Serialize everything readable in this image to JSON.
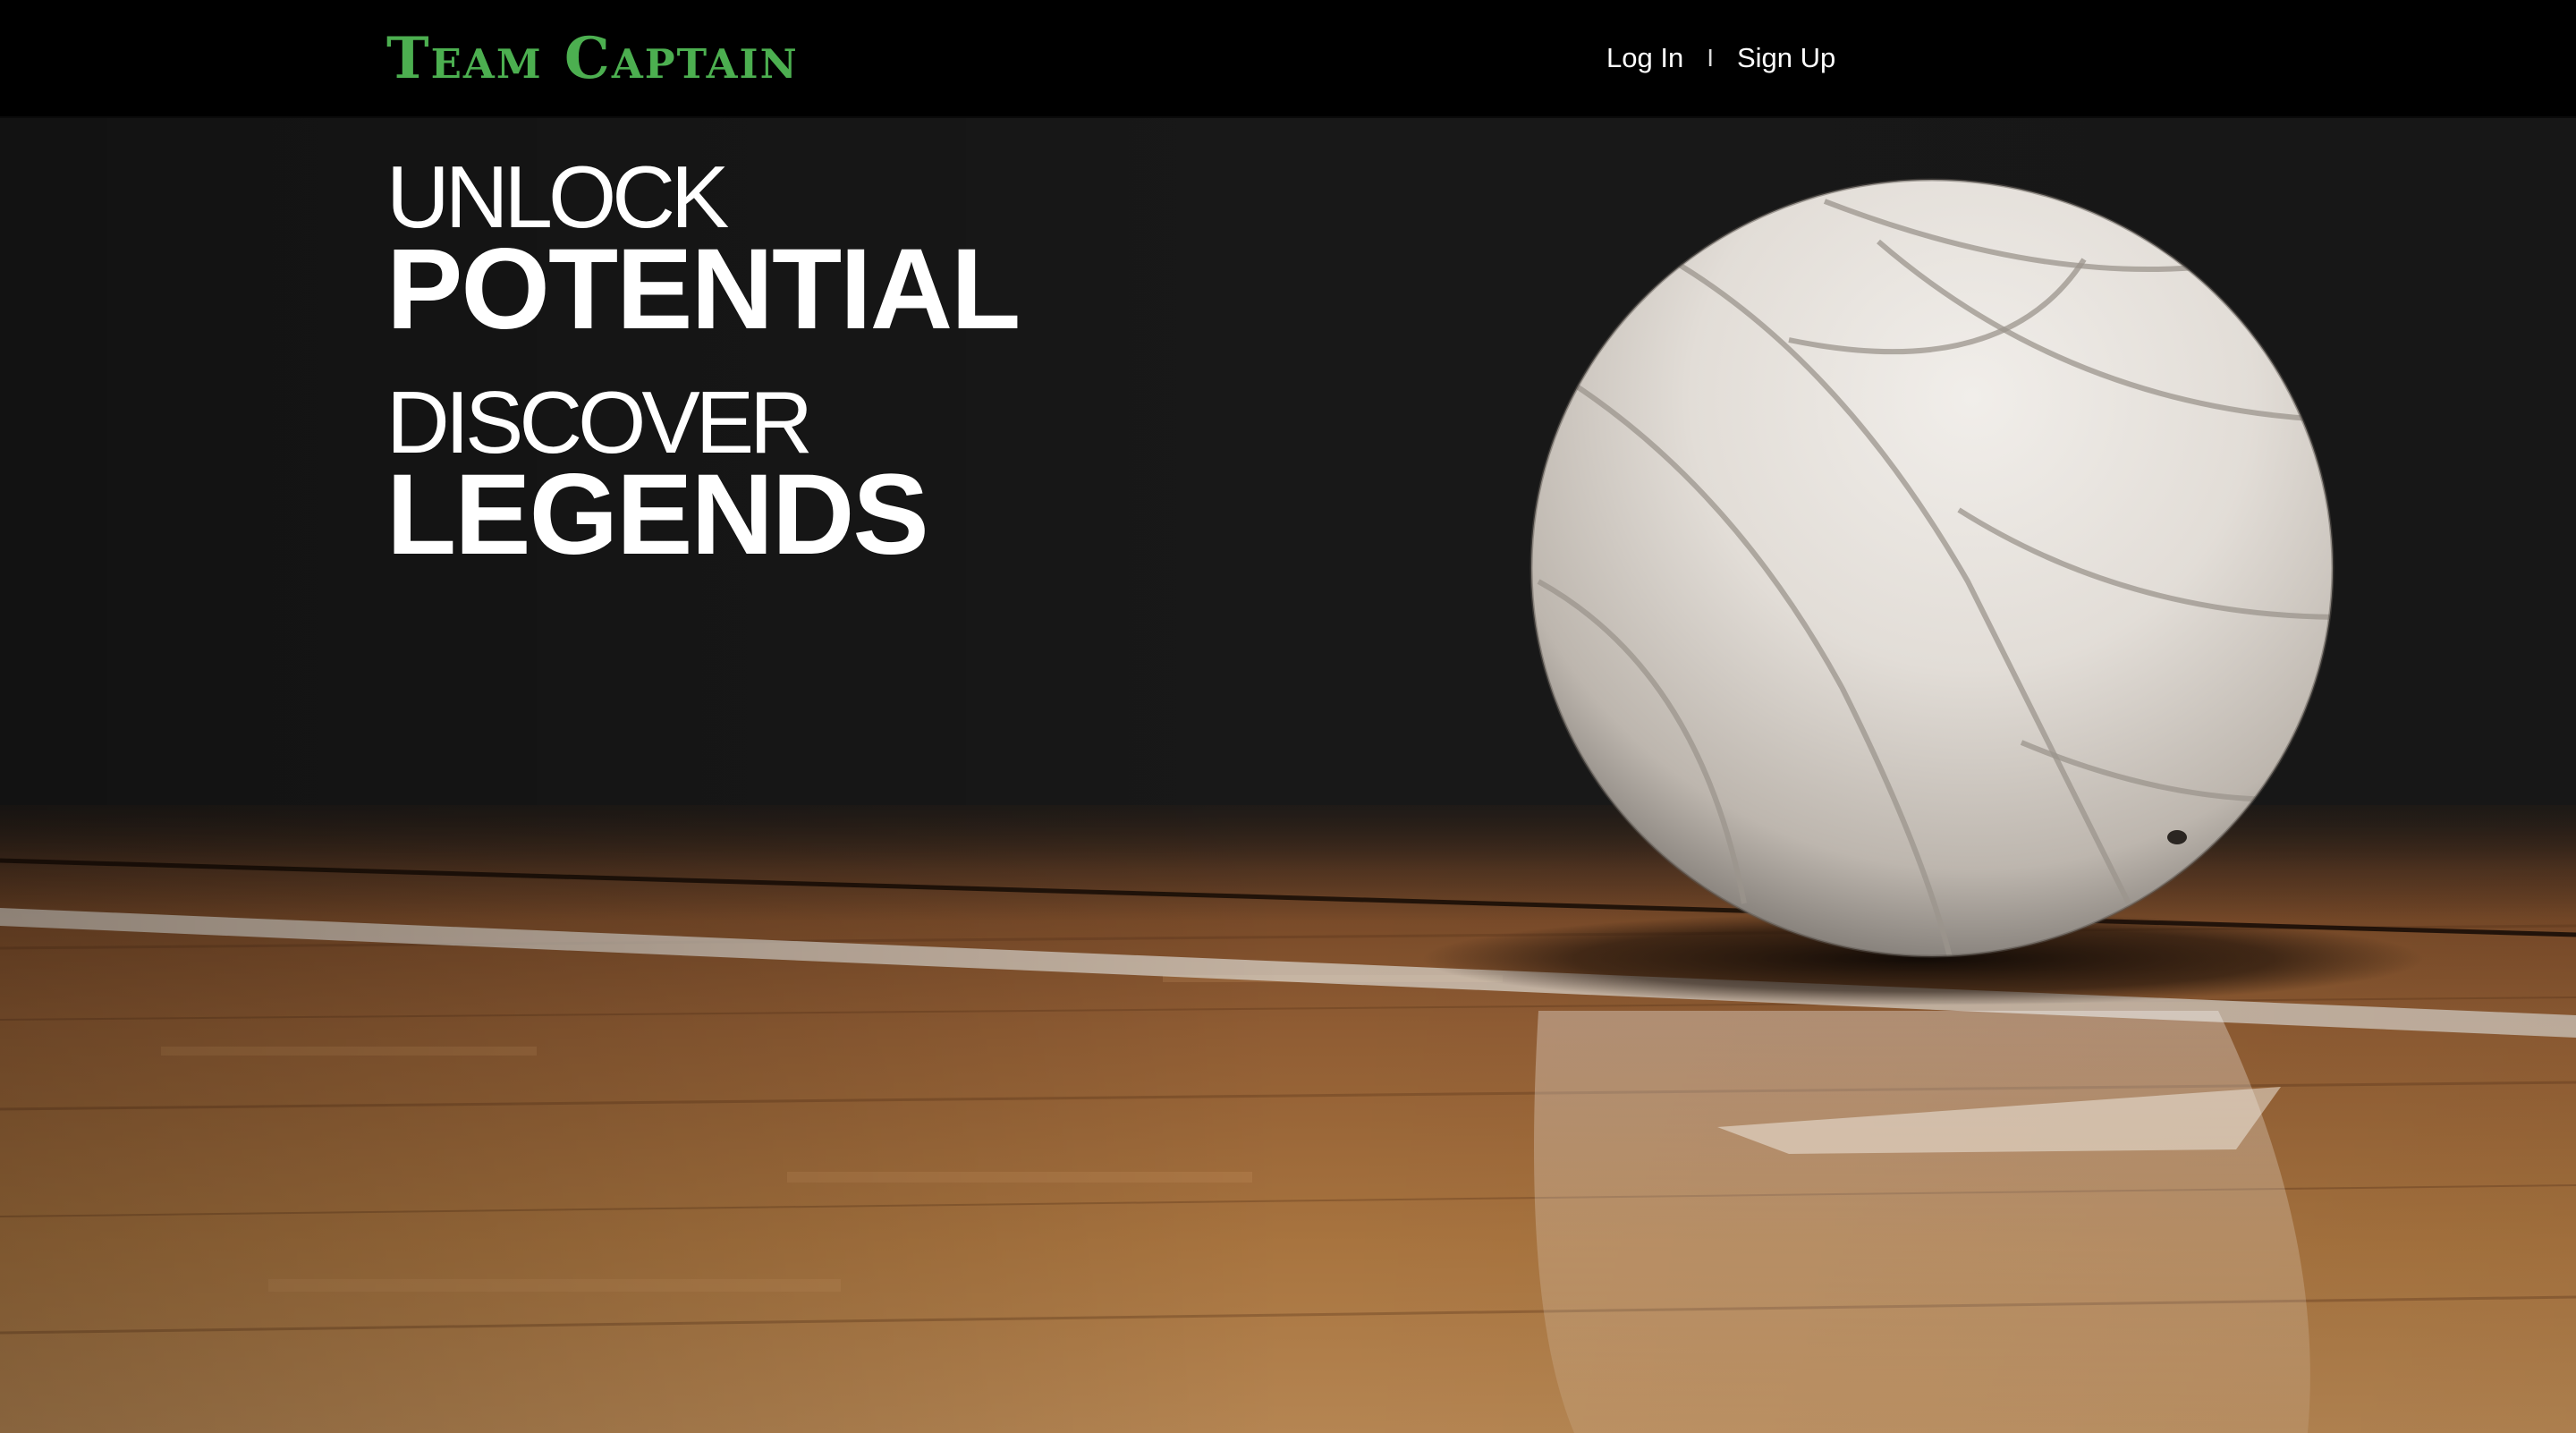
{
  "header": {
    "logo_text": "Team Captain",
    "nav": {
      "login_label": "Log In",
      "separator": "I",
      "signup_label": "Sign Up"
    }
  },
  "hero": {
    "line1_light": "UNLOCK",
    "line1_bold": "POTENTIAL",
    "line2_light": "DISCOVER",
    "line2_bold": "LEGENDS",
    "background_image": "volleyball-on-court"
  },
  "colors": {
    "brand_green": "#4caf50",
    "nav_background": "#000000",
    "hero_text": "#ffffff"
  }
}
